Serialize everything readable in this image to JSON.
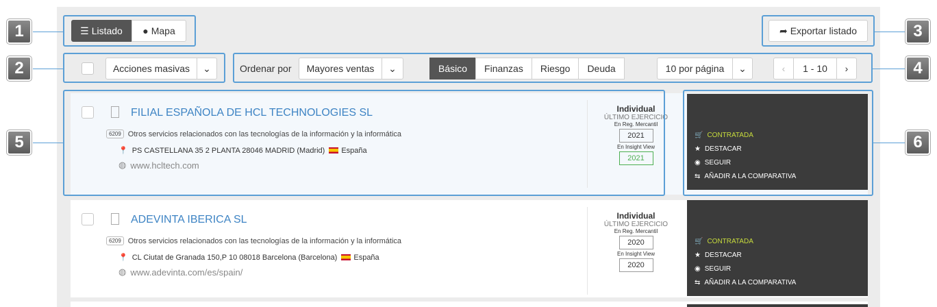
{
  "toolbar": {
    "listado": "Listado",
    "mapa": "Mapa",
    "exportar": "Exportar listado"
  },
  "controls": {
    "acciones": "Acciones masivas",
    "ordenar_label": "Ordenar por",
    "ordenar_value": "Mayores ventas",
    "tabs": [
      "Básico",
      "Finanzas",
      "Riesgo",
      "Deuda"
    ],
    "per_page": "10 por página",
    "range": "1 - 10"
  },
  "callouts": [
    "1",
    "2",
    "3",
    "4",
    "5",
    "6"
  ],
  "companies": [
    {
      "name": "FILIAL ESPAÑOLA DE HCL TECHNOLOGIES SL",
      "code": "6209",
      "activity": "Otros servicios relacionados con las tecnologías de la información y la informática",
      "address": "PS CASTELLANA 35 2 PLANTA  28046  MADRID  (Madrid)",
      "country": "España",
      "web": "www.hcltech.com",
      "type": "Individual",
      "ultimo": "ÚLTIMO EJERCICIO",
      "reg_label": "En Reg. Mercantil",
      "reg_year": "2021",
      "iv_label": "En Insight View",
      "iv_year": "2021"
    },
    {
      "name": "ADEVINTA IBERICA SL",
      "code": "6209",
      "activity": "Otros servicios relacionados con las tecnologías de la información y la informática",
      "address": "CL Ciutat de Granada 150,P 10  08018  Barcelona  (Barcelona)",
      "country": "España",
      "web": "www.adevinta.com/es/spain/",
      "type": "Individual",
      "ultimo": "ÚLTIMO EJERCICIO",
      "reg_label": "En Reg. Mercantil",
      "reg_year": "2020",
      "iv_label": "En Insight View",
      "iv_year": "2020"
    }
  ],
  "actions": {
    "contratada": "CONTRATADA",
    "destacar": "DESTACAR",
    "seguir": "SEGUIR",
    "comparar": "AÑADIR A LA COMPARATIVA"
  },
  "colors": {
    "accent": "#3e84c4",
    "highlight": "#5b9fd6",
    "contratada": "#c8dc3c",
    "dark_panel": "#3b3b3b"
  }
}
